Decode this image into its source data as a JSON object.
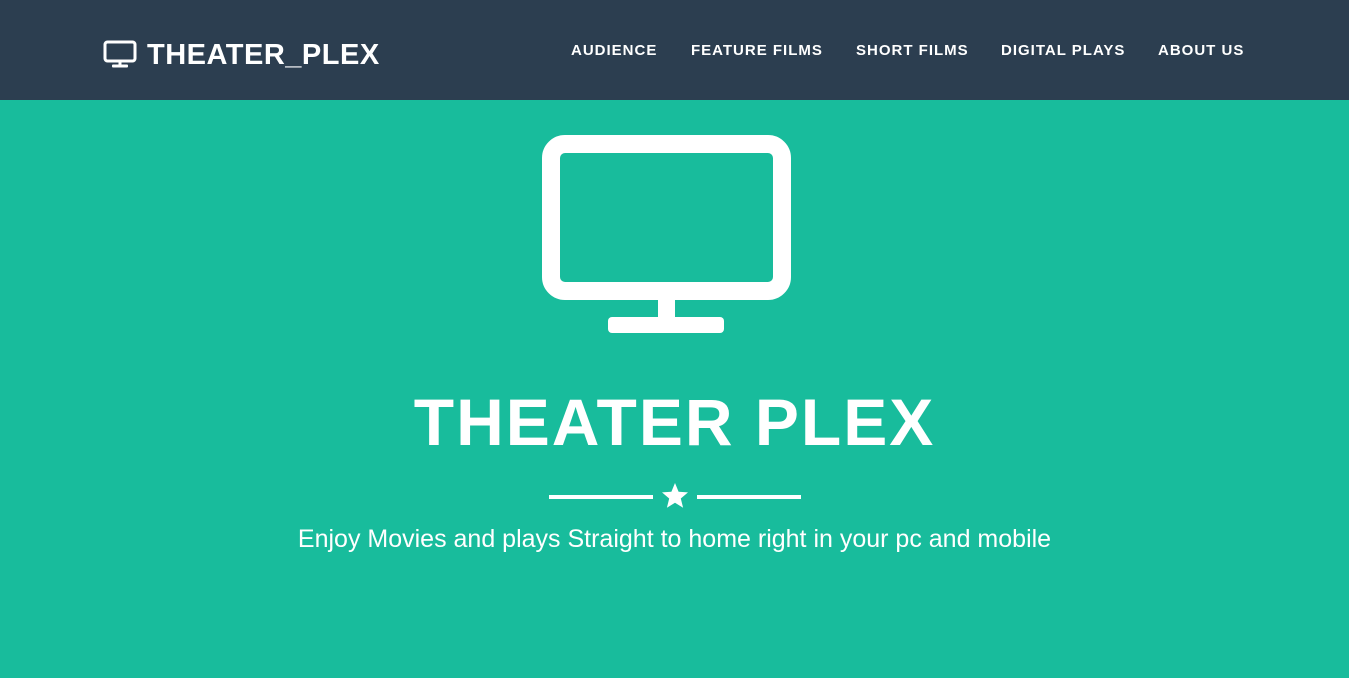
{
  "header": {
    "brand": {
      "icon": "monitor-icon",
      "label": "THEATER_PLEX"
    },
    "nav": [
      {
        "label": "AUDIENCE"
      },
      {
        "label": "FEATURE FILMS"
      },
      {
        "label": "SHORT FILMS"
      },
      {
        "label": "DIGITAL PLAYS"
      },
      {
        "label": "ABOUT US"
      }
    ],
    "background_color": "#2c3e50"
  },
  "hero": {
    "icon": "monitor-icon",
    "title": "THEATER PLEX",
    "divider_icon": "star-icon",
    "subtitle": "Enjoy Movies and plays Straight to home right in your pc and mobile",
    "background_color": "#18bc9c"
  }
}
